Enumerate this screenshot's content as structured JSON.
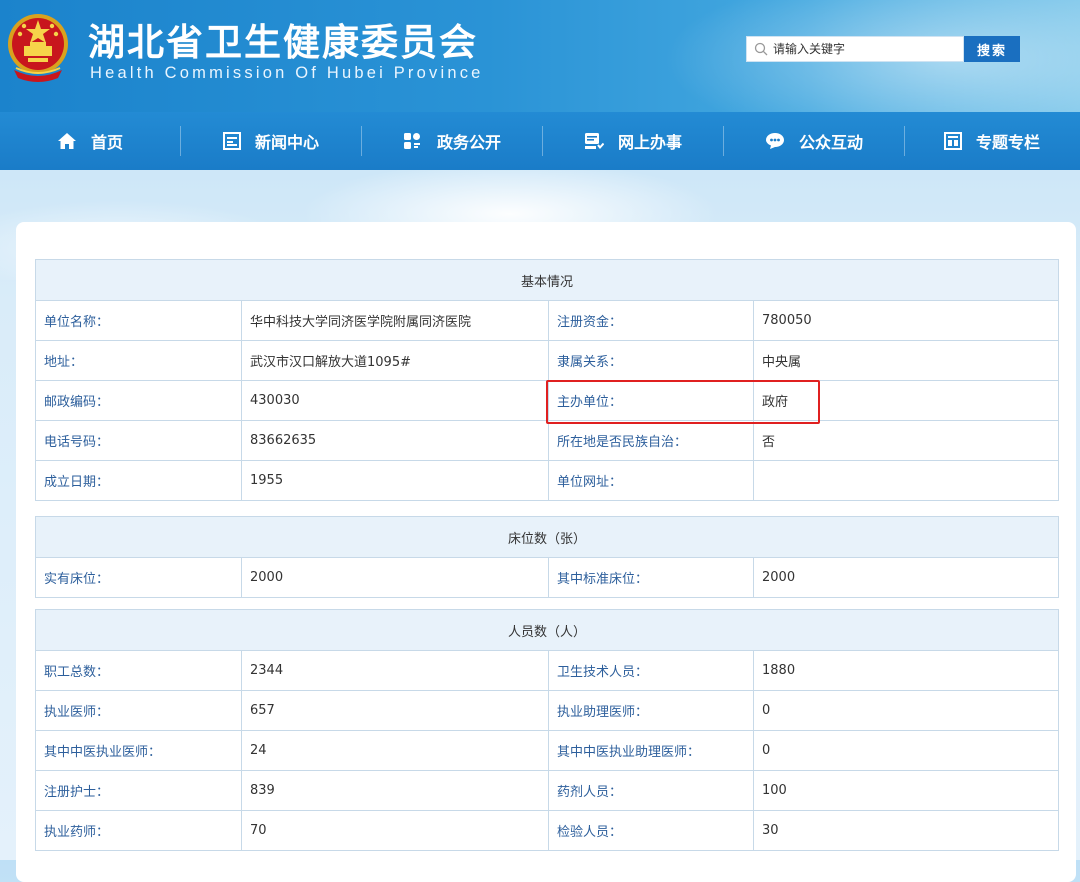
{
  "header": {
    "title_cn": "湖北省卫生健康委员会",
    "title_en": "Health Commission Of Hubei Province",
    "emblem_icon": "national-emblem-icon",
    "search_placeholder": "请输入关键字",
    "search_button": "搜索"
  },
  "nav": [
    {
      "label": "首页",
      "icon": "home-icon"
    },
    {
      "label": "新闻中心",
      "icon": "newspaper-icon"
    },
    {
      "label": "政务公开",
      "icon": "grid-icon"
    },
    {
      "label": "网上办事",
      "icon": "service-icon"
    },
    {
      "label": "公众互动",
      "icon": "chat-icon"
    },
    {
      "label": "专题专栏",
      "icon": "topic-icon"
    }
  ],
  "sections": {
    "basic": {
      "title": "基本情况",
      "rows": [
        [
          "单位名称：",
          "华中科技大学同济医学院附属同济医院",
          "注册资金：",
          "780050"
        ],
        [
          "地址：",
          "武汉市汉口解放大道1095#",
          "隶属关系：",
          "中央属"
        ],
        [
          "邮政编码：",
          "430030",
          "主办单位：",
          "政府"
        ],
        [
          "电话号码：",
          "83662635",
          "所在地是否民族自治：",
          "否"
        ],
        [
          "成立日期：",
          "1955",
          "单位网址：",
          ""
        ]
      ]
    },
    "beds": {
      "title": "床位数（张）",
      "rows": [
        [
          "实有床位：",
          "2000",
          "其中标准床位：",
          "2000"
        ]
      ]
    },
    "staff": {
      "title": "人员数（人）",
      "rows": [
        [
          "职工总数：",
          "2344",
          "卫生技术人员：",
          "1880"
        ],
        [
          "执业医师：",
          "657",
          "执业助理医师：",
          "0"
        ],
        [
          "其中中医执业医师：",
          "24",
          "其中中医执业助理医师：",
          "0"
        ],
        [
          "注册护士：",
          "839",
          "药剂人员：",
          "100"
        ],
        [
          "执业药师：",
          "70",
          "检验人员：",
          "30"
        ]
      ]
    }
  },
  "colors": {
    "header_blue": "#1b83cc",
    "nav_blue": "#1a7cc8",
    "label_blue": "#2d5f9c",
    "section_bg": "#e8f2fa",
    "border": "#c7d9e8",
    "highlight_red": "#e02020"
  }
}
